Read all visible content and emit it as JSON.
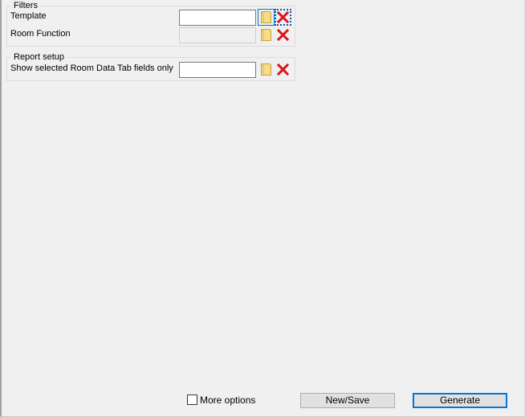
{
  "filters": {
    "title": "Filters",
    "template_label": "Template",
    "template_value": "",
    "room_function_label": "Room Function",
    "room_function_value": ""
  },
  "report_setup": {
    "title": "Report setup",
    "show_selected_label": "Show selected Room Data Tab fields only",
    "show_selected_value": ""
  },
  "footer": {
    "more_options_label": "More options",
    "more_options_checked": false,
    "new_save_label": "New/Save",
    "generate_label": "Generate"
  },
  "icons": {
    "browse": "folder-icon",
    "clear": "red-x-icon"
  },
  "colors": {
    "folder": "#f7dc8a",
    "clear_x": "#d9141b",
    "focus": "#0078d7"
  }
}
